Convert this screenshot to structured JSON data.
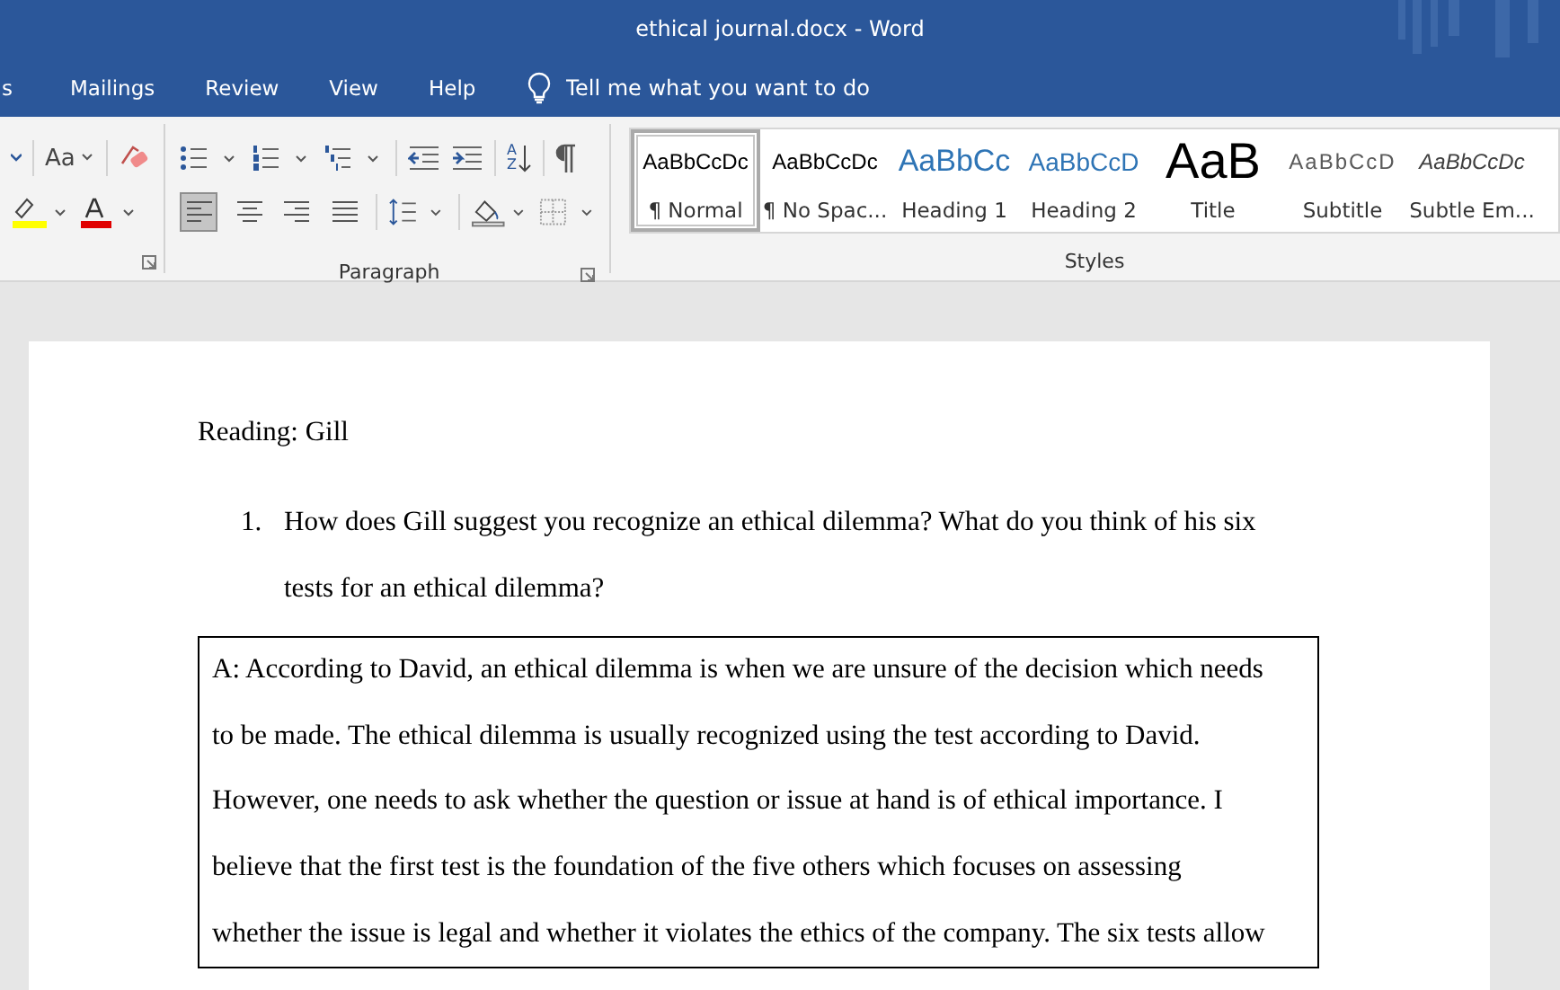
{
  "window": {
    "title": "ethical journal.docx  -  Word"
  },
  "tabs": [
    {
      "label": "s",
      "selected": false
    },
    {
      "label": "Mailings",
      "selected": false
    },
    {
      "label": "Review",
      "selected": false
    },
    {
      "label": "View",
      "selected": false
    },
    {
      "label": "Help",
      "selected": false
    }
  ],
  "tell_me": {
    "placeholder": "Tell me what you want to do"
  },
  "ribbon": {
    "font": {
      "change_case": "Aa"
    },
    "paragraph": {
      "label": "Paragraph",
      "sort_letters": [
        "A",
        "Z"
      ],
      "alignment": [
        {
          "kind": "left",
          "selected": true
        },
        {
          "kind": "center",
          "selected": false
        },
        {
          "kind": "right",
          "selected": false
        },
        {
          "kind": "justify",
          "selected": false
        }
      ]
    },
    "styles": {
      "label": "Styles",
      "items": [
        {
          "kind": "normal",
          "preview": "AaBbCcDc",
          "label": "¶ Normal",
          "selected": true
        },
        {
          "kind": "normal",
          "preview": "AaBbCcDc",
          "label": "¶ No Spac...",
          "selected": false
        },
        {
          "kind": "heading1",
          "preview": "AaBbCc",
          "label": "Heading 1",
          "selected": false
        },
        {
          "kind": "heading2",
          "preview": "AaBbCcD",
          "label": "Heading 2",
          "selected": false
        },
        {
          "kind": "title",
          "preview": "AaB",
          "label": "Title",
          "selected": false
        },
        {
          "kind": "subtitle",
          "preview": "AaBbCcD",
          "label": "Subtitle",
          "selected": false
        },
        {
          "kind": "emphasis",
          "preview": "AaBbCcDc",
          "label": "Subtle Em...",
          "selected": false
        }
      ]
    }
  },
  "document": {
    "reading": "Reading: Gill",
    "question": {
      "number": "1.",
      "lines": [
        "How does Gill suggest you recognize an ethical dilemma? What do you think of his six",
        "tests for an ethical dilemma?"
      ]
    },
    "answer_lines": [
      "A: According to David, an ethical dilemma is when we are unsure of the decision which needs",
      "to be made. The ethical dilemma is usually recognized using the test according to David.",
      "However, one needs to ask whether the question or issue at hand is of ethical importance. I",
      "believe that the first test is the foundation of the five others which focuses on assessing",
      "whether the issue is legal and whether it violates the ethics of the company. The six tests allow"
    ]
  }
}
